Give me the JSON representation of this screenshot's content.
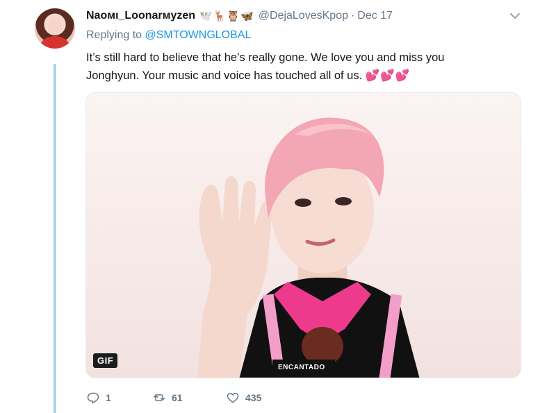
{
  "tweet": {
    "display_name": "Naoмι_Loonarмyzen",
    "name_emojis": "🕊️🦌🦉🦋",
    "handle": "@DejaLovesKpop",
    "separator": "·",
    "date": "Dec 17",
    "replying_prefix": "Replying to",
    "replying_to": "@SMTOWNGLOBAL",
    "text": "It’s still hard to believe that he’s really gone. We love you and miss you Jonghyun. Your music and voice has touched all of us.",
    "text_emojis": "💕💕💕",
    "media": {
      "badge": "GIF",
      "mic_label": "ENCANTADO"
    },
    "actions": {
      "reply_icon": "reply-icon",
      "reply_count": "1",
      "retweet_icon": "retweet-icon",
      "retweet_count": "61",
      "like_icon": "heart-icon",
      "like_count": "435"
    },
    "colors": {
      "link": "#1b95e0",
      "muted": "#657786",
      "thread_line": "#a8d3e6",
      "hair": "#f3a6b4",
      "shirt": "#ee3a8c"
    }
  }
}
